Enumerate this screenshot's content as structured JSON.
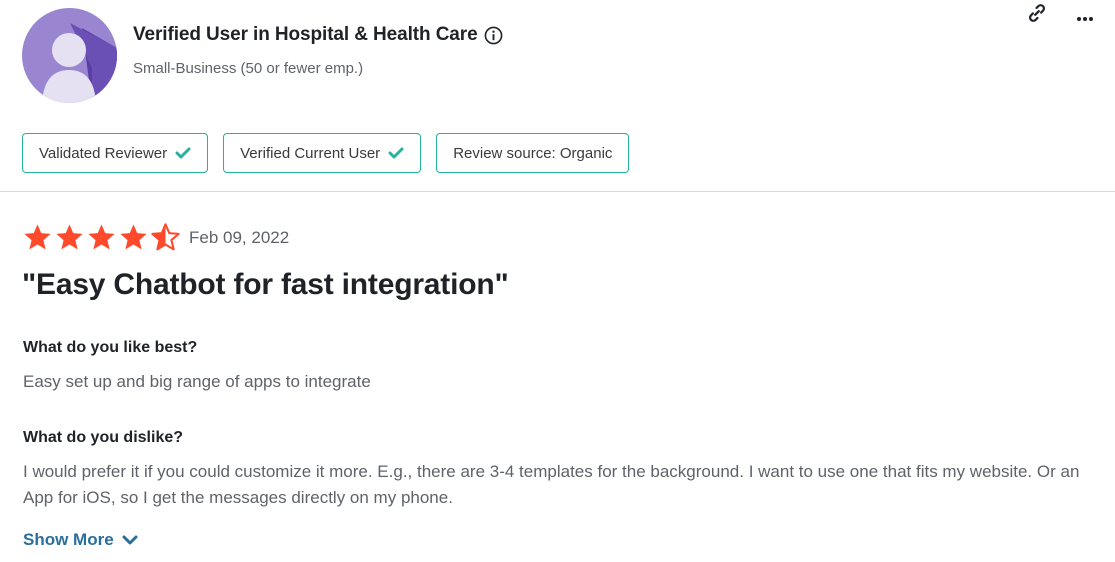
{
  "reviewer": {
    "name": "Verified User in Hospital & Health Care",
    "segment": "Small-Business (50 or fewer emp.)",
    "avatar_icon": "person-silhouette-icon",
    "info_icon": "info-circle-icon"
  },
  "actions": {
    "link_icon": "link-icon",
    "more_icon": "more-horizontal-icon"
  },
  "badges": [
    {
      "label": "Validated Reviewer",
      "icon": "check-icon"
    },
    {
      "label": "Verified Current User",
      "icon": "check-icon"
    },
    {
      "label": "Review source: Organic"
    }
  ],
  "review": {
    "rating": 4.5,
    "max_rating": 5,
    "date": "Feb 09, 2022",
    "title": "\"Easy Chatbot for fast integration\"",
    "questions": [
      {
        "question": "What do you like best?",
        "answer": "Easy set up and big range of apps to integrate"
      },
      {
        "question": "What do you dislike?",
        "answer": "I would prefer it if you could customize it more. E.g., there are 3-4 templates for the background. I want to use one that fits my website. Or an App for iOS, so I get the messages directly on my phone."
      }
    ],
    "show_more_label": "Show More"
  },
  "colors": {
    "accent_teal": "#25b39e",
    "star_color": "#ff492c",
    "link_blue": "#2a6f9b",
    "avatar_bg": "#8e78c8",
    "avatar_shadow": "#5a3ea6"
  }
}
